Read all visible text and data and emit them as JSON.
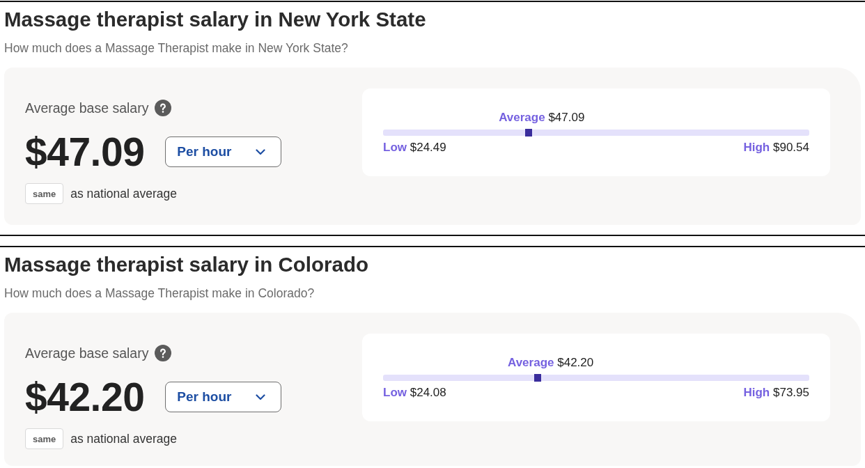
{
  "sections": [
    {
      "title": "Massage therapist salary in New York State",
      "subtitle": "How much does a Massage Therapist make in New York State?",
      "salary": {
        "label": "Average base salary",
        "value": "$47.09",
        "period": "Per hour",
        "comparison": "same",
        "comparison_text": "as national average"
      },
      "range": {
        "average_label": "Average",
        "average_value": "$47.09",
        "level": 0.342,
        "low_label": "Low",
        "low_value": "$24.49",
        "high_label": "High",
        "high_value": "$90.54"
      }
    },
    {
      "title": "Massage therapist salary in Colorado",
      "subtitle": "How much does a Massage Therapist make in Colorado?",
      "salary": {
        "label": "Average base salary",
        "value": "$42.20",
        "period": "Per hour",
        "comparison": "same",
        "comparison_text": "as national average"
      },
      "range": {
        "average_label": "Average",
        "average_value": "$42.20",
        "level": 0.363,
        "low_label": "Low",
        "low_value": "$24.08",
        "high_label": "High",
        "high_value": "$73.95"
      }
    }
  ]
}
